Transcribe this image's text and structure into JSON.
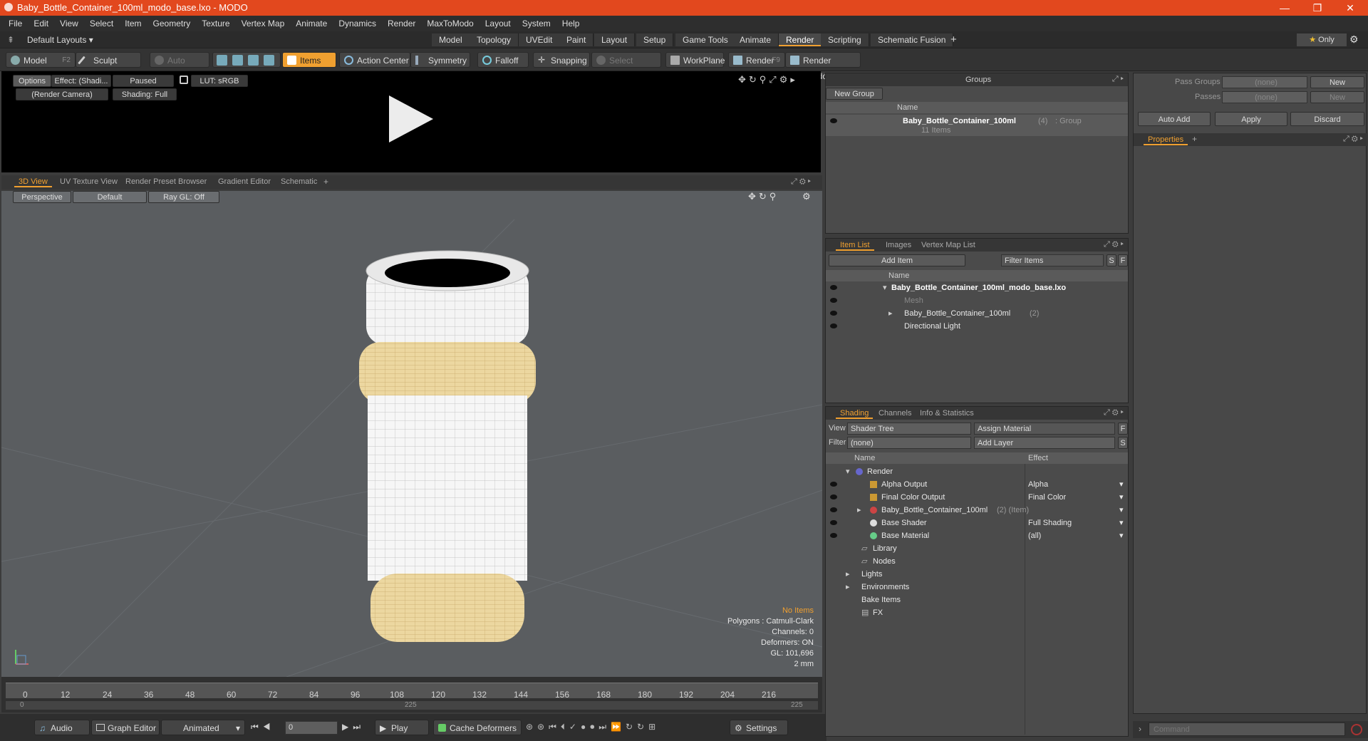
{
  "window": {
    "title": "Baby_Bottle_Container_100ml_modo_base.lxo - MODO"
  },
  "menu": [
    "File",
    "Edit",
    "View",
    "Select",
    "Item",
    "Geometry",
    "Texture",
    "Vertex Map",
    "Animate",
    "Dynamics",
    "Render",
    "MaxToModo",
    "Layout",
    "System",
    "Help"
  ],
  "layout_bar": {
    "layouts_label": "Default Layouts",
    "tabs": [
      "Model",
      "Topology",
      "UVEdit",
      "Paint",
      "Layout",
      "Setup",
      "Game Tools",
      "Animate",
      "Render",
      "Scripting",
      "Schematic Fusion"
    ],
    "active_tab": "Render",
    "only_label": "Only"
  },
  "toolbar": {
    "model": "Model",
    "model_key": "F2",
    "sculpt": "Sculpt",
    "auto_select": "Auto Select",
    "items": "Items",
    "action_center": "Action Center",
    "symmetry": "Symmetry",
    "falloff": "Falloff",
    "snapping": "Snapping",
    "select_through": "Select Through",
    "workplane": "WorkPlane",
    "render": "Render",
    "render_key": "F9",
    "render_window": "Render Window"
  },
  "render_preview": {
    "options": "Options",
    "effect": "Effect: (Shadi...",
    "paused": "Paused",
    "lut": "LUT: sRGB",
    "camera": "(Render Camera)",
    "shading": "Shading: Full"
  },
  "view_tabs": [
    "3D View",
    "UV Texture View",
    "Render Preset Browser",
    "Gradient Editor",
    "Schematic"
  ],
  "viewport": {
    "perspective": "Perspective",
    "default": "Default",
    "raygl": "Ray GL: Off",
    "stats": {
      "no_items": "No Items",
      "polygons": "Polygons : Catmull-Clark",
      "channels": "Channels: 0",
      "deformers": "Deformers: ON",
      "gl": "GL: 101,696",
      "scale": "2 mm"
    }
  },
  "timeline": {
    "ticks": [
      "0",
      "12",
      "24",
      "36",
      "48",
      "60",
      "72",
      "84",
      "96",
      "108",
      "120",
      "132",
      "144",
      "156",
      "168",
      "180",
      "192",
      "204",
      "216"
    ],
    "start": "0",
    "mid": "225",
    "end": "225"
  },
  "bottom": {
    "audio": "Audio",
    "graph_editor": "Graph Editor",
    "animated": "Animated",
    "frame": "0",
    "play": "Play",
    "cache_deformers": "Cache Deformers",
    "settings": "Settings"
  },
  "groups": {
    "title": "Groups",
    "new_group": "New Group",
    "col_name": "Name",
    "item_name": "Baby_Bottle_Container_100ml",
    "item_count": "(4)",
    "item_type": ": Group",
    "item_sub": "11 Items"
  },
  "item_list": {
    "tabs": [
      "Item List",
      "Images",
      "Vertex Map List"
    ],
    "add_item": "Add Item",
    "filter": "Filter Items",
    "s": "S",
    "f": "F",
    "col_name": "Name",
    "rows": [
      {
        "label": "Baby_Bottle_Container_100ml_modo_base.lxo",
        "extra": ""
      },
      {
        "label": "Mesh",
        "extra": ""
      },
      {
        "label": "Baby_Bottle_Container_100ml",
        "extra": "(2)"
      },
      {
        "label": "Directional Light",
        "extra": ""
      }
    ]
  },
  "shading": {
    "tabs": [
      "Shading",
      "Channels",
      "Info & Statistics"
    ],
    "view_label": "View",
    "view_value": "Shader Tree",
    "assign": "Assign Material",
    "f": "F",
    "filter_label": "Filter",
    "filter_value": "(none)",
    "add_layer": "Add Layer",
    "s": "S",
    "col_name": "Name",
    "col_effect": "Effect",
    "rows": [
      {
        "name": "Render",
        "effect": "",
        "extra": ""
      },
      {
        "name": "Alpha Output",
        "effect": "Alpha",
        "extra": ""
      },
      {
        "name": "Final Color Output",
        "effect": "Final Color",
        "extra": ""
      },
      {
        "name": "Baby_Bottle_Container_100ml",
        "effect": "",
        "extra": "(2) (Item)"
      },
      {
        "name": "Base Shader",
        "effect": "Full Shading",
        "extra": ""
      },
      {
        "name": "Base Material",
        "effect": "(all)",
        "extra": ""
      },
      {
        "name": "Library",
        "effect": "",
        "extra": ""
      },
      {
        "name": "Nodes",
        "effect": "",
        "extra": ""
      },
      {
        "name": "Lights",
        "effect": "",
        "extra": ""
      },
      {
        "name": "Environments",
        "effect": "",
        "extra": ""
      },
      {
        "name": "Bake Items",
        "effect": "",
        "extra": ""
      },
      {
        "name": "FX",
        "effect": "",
        "extra": ""
      }
    ]
  },
  "passes": {
    "pass_groups": "Pass Groups",
    "passes": "Passes",
    "none": "(none)",
    "new": "New",
    "auto_add": "Auto Add",
    "apply": "Apply",
    "discard": "Discard",
    "properties": "Properties"
  },
  "command": {
    "placeholder": "Command"
  },
  "colors": {
    "accent": "#f0a030",
    "titlebar": "#e2481e"
  }
}
